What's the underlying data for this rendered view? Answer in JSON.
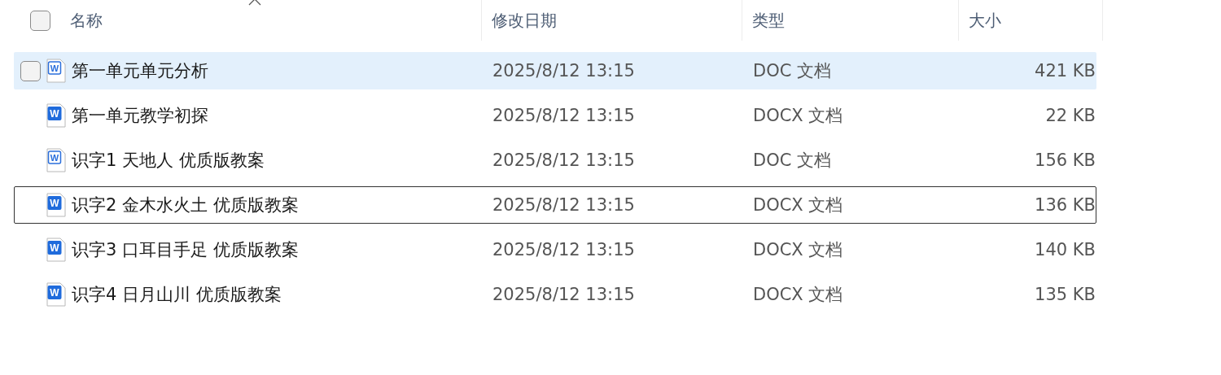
{
  "header": {
    "checked": false,
    "columns": [
      {
        "label": "名称",
        "sorted": true
      },
      {
        "label": "修改日期",
        "sorted": false
      },
      {
        "label": "类型",
        "sorted": false
      },
      {
        "label": "大小",
        "sorted": false
      }
    ]
  },
  "rows": [
    {
      "name": "第一单元单元分析",
      "modified": "2025/8/12 13:15",
      "type": "DOC 文档",
      "size": "421 KB",
      "kind": "doc",
      "icon_letter": "W",
      "hovered": true,
      "focused": false,
      "checked": false
    },
    {
      "name": "第一单元教学初探",
      "modified": "2025/8/12 13:15",
      "type": "DOCX 文档",
      "size": "22 KB",
      "kind": "docx",
      "icon_letter": "W",
      "hovered": false,
      "focused": false,
      "checked": false
    },
    {
      "name": "识字1 天地人 优质版教案",
      "modified": "2025/8/12 13:15",
      "type": "DOC 文档",
      "size": "156 KB",
      "kind": "doc",
      "icon_letter": "W",
      "hovered": false,
      "focused": false,
      "checked": false
    },
    {
      "name": "识字2 金木水火土 优质版教案",
      "modified": "2025/8/12 13:15",
      "type": "DOCX 文档",
      "size": "136 KB",
      "kind": "docx",
      "icon_letter": "W",
      "hovered": false,
      "focused": true,
      "checked": false
    },
    {
      "name": "识字3 口耳目手足 优质版教案",
      "modified": "2025/8/12 13:15",
      "type": "DOCX 文档",
      "size": "140 KB",
      "kind": "docx",
      "icon_letter": "W",
      "hovered": false,
      "focused": false,
      "checked": false
    },
    {
      "name": "识字4 日月山川 优质版教案",
      "modified": "2025/8/12 13:15",
      "type": "DOCX 文档",
      "size": "135 KB",
      "kind": "docx",
      "icon_letter": "W",
      "hovered": false,
      "focused": false,
      "checked": false
    }
  ]
}
